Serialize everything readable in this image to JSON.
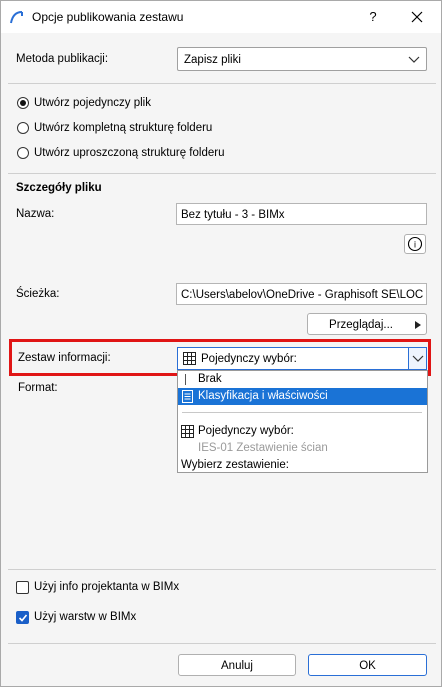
{
  "window": {
    "title": "Opcje publikowania zestawu",
    "help_label": "?"
  },
  "method": {
    "label": "Metoda publikacji:",
    "value": "Zapisz pliki"
  },
  "radios": [
    {
      "label": "Utwórz pojedynczy plik",
      "checked": true
    },
    {
      "label": "Utwórz kompletną strukturę folderu",
      "checked": false
    },
    {
      "label": "Utwórz uproszczoną strukturę folderu",
      "checked": false
    }
  ],
  "details": {
    "heading": "Szczegóły pliku",
    "name_label": "Nazwa:",
    "name_value": "Bez tytułu - 3 - BIMx",
    "path_label": "Ścieżka:",
    "path_value": "C:\\Users\\abelov\\OneDrive - Graphisoft SE\\LOC I",
    "browse_label": "Przeglądaj...",
    "info_icon_label": "i"
  },
  "info_set": {
    "label": "Zestaw informacji:",
    "value": "Pojedynczy wybór:",
    "format_label": "Format:",
    "options": [
      {
        "label": "Brak",
        "state": "normal",
        "icon": "none"
      },
      {
        "label": "Klasyfikacja i właściwości",
        "state": "selected",
        "icon": "document-icon"
      },
      {
        "label": "Pojedynczy wybór:",
        "state": "normal",
        "icon": "table-icon"
      },
      {
        "label": "IES-01 Zestawienie ścian",
        "state": "disabled",
        "icon": "none"
      },
      {
        "label": "Wybierz zestawienie:",
        "state": "normal",
        "icon": "none"
      }
    ]
  },
  "checkboxes": [
    {
      "label": "Użyj info projektanta w BIMx",
      "checked": false
    },
    {
      "label": "Użyj warstw w BIMx",
      "checked": true
    }
  ],
  "footer": {
    "cancel_label": "Anuluj",
    "ok_label": "OK"
  },
  "colors": {
    "accent": "#1a73d6",
    "highlight_box": "#e01515"
  }
}
